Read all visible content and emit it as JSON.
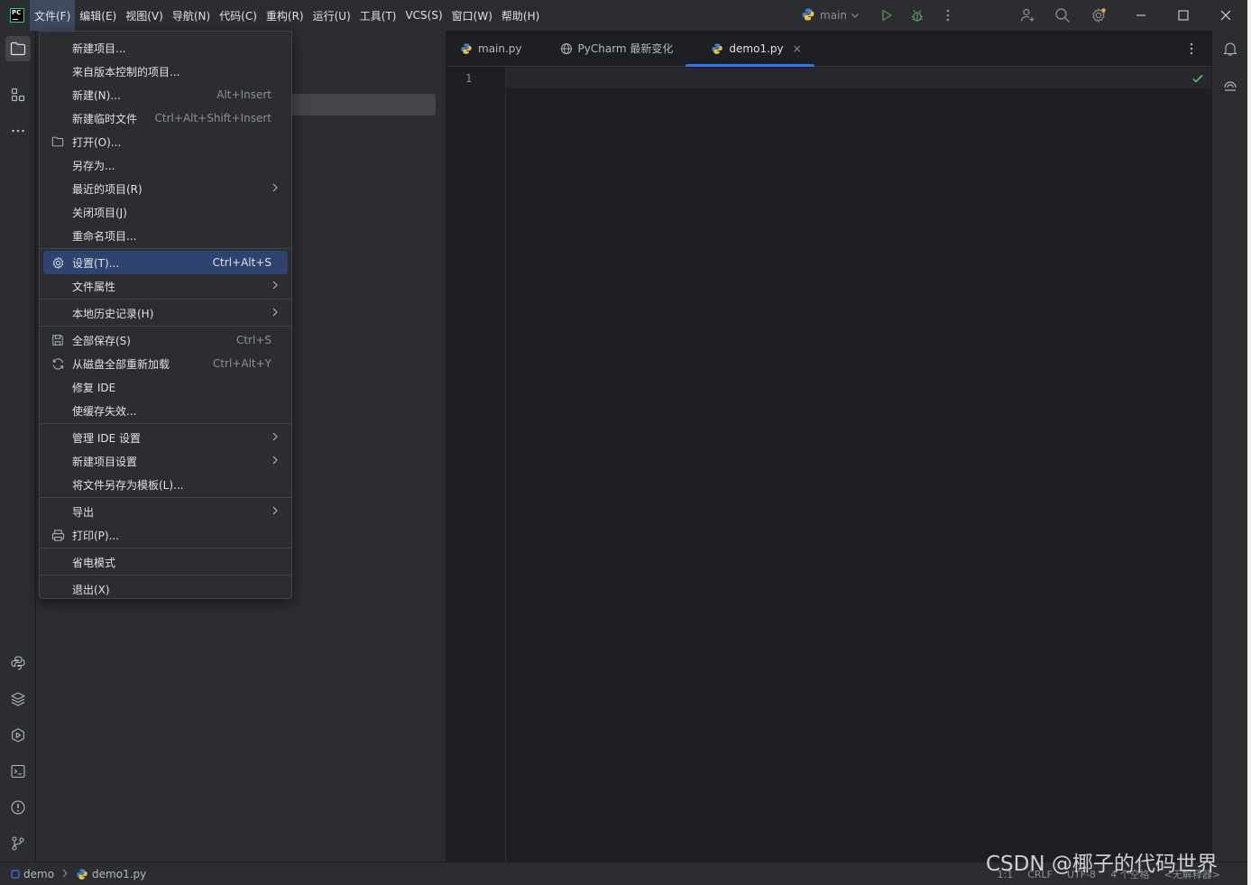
{
  "app": {
    "logo_text": "PC",
    "menus": [
      "文件(F)",
      "编辑(E)",
      "视图(V)",
      "导航(N)",
      "代码(C)",
      "重构(R)",
      "运行(U)",
      "工具(T)",
      "VCS(S)",
      "窗口(W)",
      "帮助(H)"
    ],
    "branch": "main"
  },
  "file_menu": {
    "items": [
      {
        "label": "新建项目...",
        "shortcut": "",
        "icon": "",
        "submenu": false
      },
      {
        "label": "来自版本控制的项目...",
        "shortcut": "",
        "icon": "",
        "submenu": false
      },
      {
        "label": "新建(N)...",
        "shortcut": "Alt+Insert",
        "icon": "",
        "submenu": false
      },
      {
        "label": "新建临时文件",
        "shortcut": "Ctrl+Alt+Shift+Insert",
        "icon": "",
        "submenu": false
      },
      {
        "label": "打开(O)...",
        "shortcut": "",
        "icon": "folder-icon",
        "submenu": false
      },
      {
        "label": "另存为...",
        "shortcut": "",
        "icon": "",
        "submenu": false
      },
      {
        "label": "最近的项目(R)",
        "shortcut": "",
        "icon": "",
        "submenu": true
      },
      {
        "label": "关闭项目(J)",
        "shortcut": "",
        "icon": "",
        "submenu": false
      },
      {
        "label": "重命名项目...",
        "shortcut": "",
        "icon": "",
        "submenu": false
      },
      {
        "separator": true
      },
      {
        "label": "设置(T)...",
        "shortcut": "Ctrl+Alt+S",
        "icon": "gear-icon",
        "submenu": false,
        "highlight": true
      },
      {
        "label": "文件属性",
        "shortcut": "",
        "icon": "",
        "submenu": true
      },
      {
        "separator": true
      },
      {
        "label": "本地历史记录(H)",
        "shortcut": "",
        "icon": "",
        "submenu": true
      },
      {
        "separator": true
      },
      {
        "label": "全部保存(S)",
        "shortcut": "Ctrl+S",
        "icon": "save-icon",
        "submenu": false
      },
      {
        "label": "从磁盘全部重新加载",
        "shortcut": "Ctrl+Alt+Y",
        "icon": "reload-icon",
        "submenu": false
      },
      {
        "label": "修复 IDE",
        "shortcut": "",
        "icon": "",
        "submenu": false
      },
      {
        "label": "使缓存失效...",
        "shortcut": "",
        "icon": "",
        "submenu": false
      },
      {
        "separator": true
      },
      {
        "label": "管理 IDE 设置",
        "shortcut": "",
        "icon": "",
        "submenu": true
      },
      {
        "label": "新建项目设置",
        "shortcut": "",
        "icon": "",
        "submenu": true
      },
      {
        "label": "将文件另存为模板(L)...",
        "shortcut": "",
        "icon": "",
        "submenu": false
      },
      {
        "separator": true
      },
      {
        "label": "导出",
        "shortcut": "",
        "icon": "",
        "submenu": true
      },
      {
        "label": "打印(P)...",
        "shortcut": "",
        "icon": "print-icon",
        "submenu": false
      },
      {
        "separator": true
      },
      {
        "label": "省电模式",
        "shortcut": "",
        "icon": "",
        "submenu": false
      },
      {
        "separator": true
      },
      {
        "label": "退出(X)",
        "shortcut": "",
        "icon": "",
        "submenu": false
      }
    ]
  },
  "editor": {
    "tabs": [
      {
        "label": "main.py",
        "icon": "python-file-icon",
        "active": false,
        "closable": false
      },
      {
        "label": "PyCharm 最新变化",
        "icon": "globe-icon",
        "active": false,
        "closable": false
      },
      {
        "label": "demo1.py",
        "icon": "python-file-icon",
        "active": true,
        "closable": true
      }
    ],
    "close_glyph": "×",
    "line_numbers": [
      "1"
    ]
  },
  "status": {
    "breadcrumbs": [
      "demo",
      "demo1.py"
    ],
    "position": "1:1",
    "line_ending": "CRLF",
    "encoding": "UTF-8",
    "indent": "4 个空格",
    "interpreter": "<无解释器>"
  },
  "watermark": "CSDN @椰子的代码世界",
  "colors": {
    "accent": "#3574f0",
    "menu_highlight": "#2e436e",
    "run_green": "#57965c",
    "check_green": "#5fb865"
  }
}
